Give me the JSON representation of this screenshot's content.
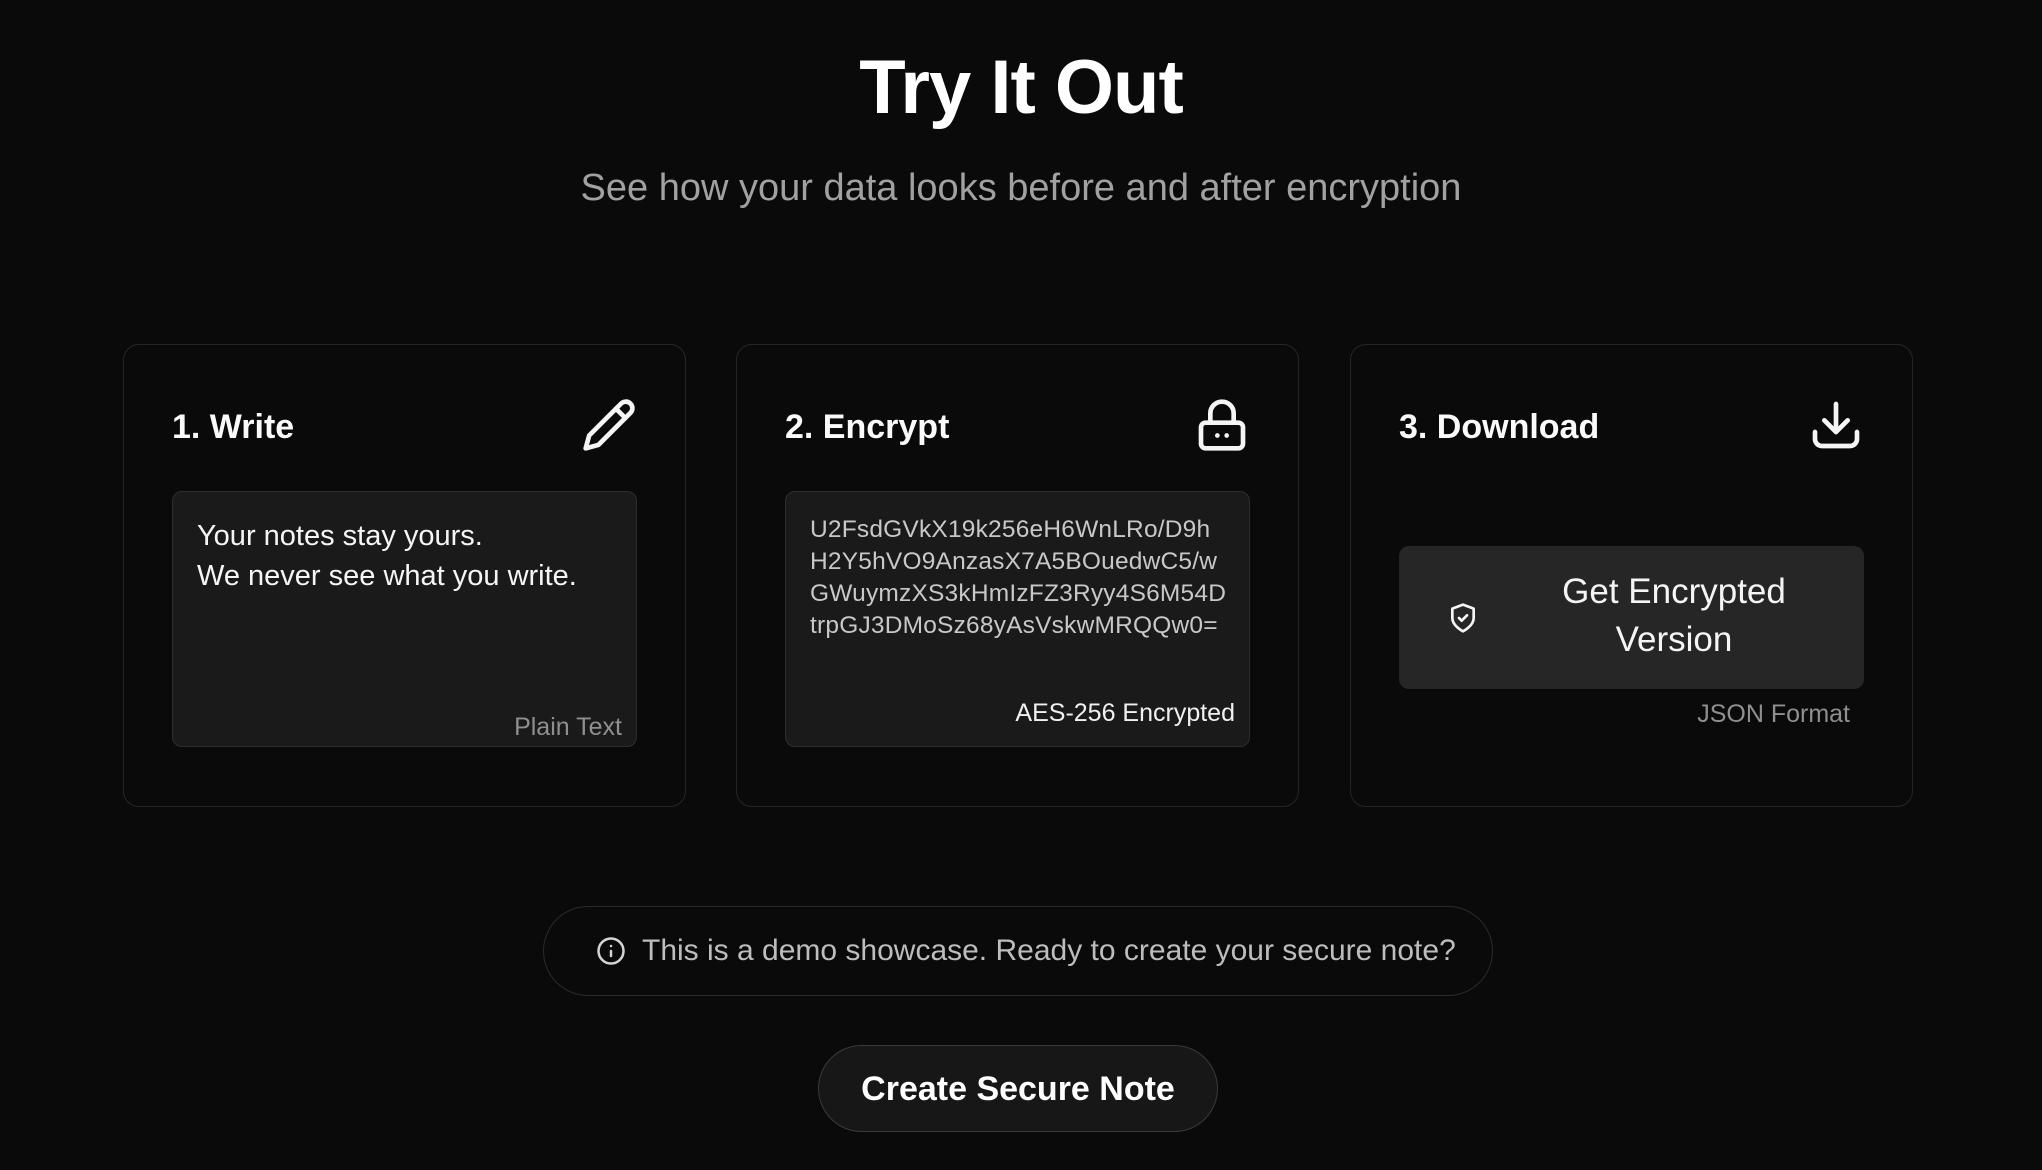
{
  "header": {
    "title": "Try It Out",
    "subtitle": "See how your data looks before and after encryption"
  },
  "steps": [
    {
      "title": "1. Write",
      "icon": "pencil-icon",
      "content": "Your notes stay yours.\nWe never see what you write.",
      "caption": "Plain Text"
    },
    {
      "title": "2. Encrypt",
      "icon": "lock-icon",
      "content": "U2FsdGVkX19k256eH6WnLRo/D9hH2Y5hVO9AnzasX7A5BOuedwC5/wGWuymzXS3kHmIzFZ3Ryy4S6M54DtrpGJ3DMoSz68yAsVskwMRQQw0=",
      "caption": "AES-256 Encrypted"
    },
    {
      "title": "3. Download",
      "icon": "download-icon",
      "button_label": "Get Encrypted Version",
      "button_icon": "shield-check-icon",
      "caption": "JSON Format"
    }
  ],
  "notice": {
    "icon": "info-icon",
    "text": "This is a demo showcase. Ready to create your secure note?"
  },
  "cta": {
    "label": "Create Secure Note"
  },
  "colors": {
    "background": "#0a0a0a",
    "card_border": "#262626",
    "panel_background": "#1a1a1a",
    "button_background": "#262626",
    "muted_text": "#a1a1a1"
  }
}
